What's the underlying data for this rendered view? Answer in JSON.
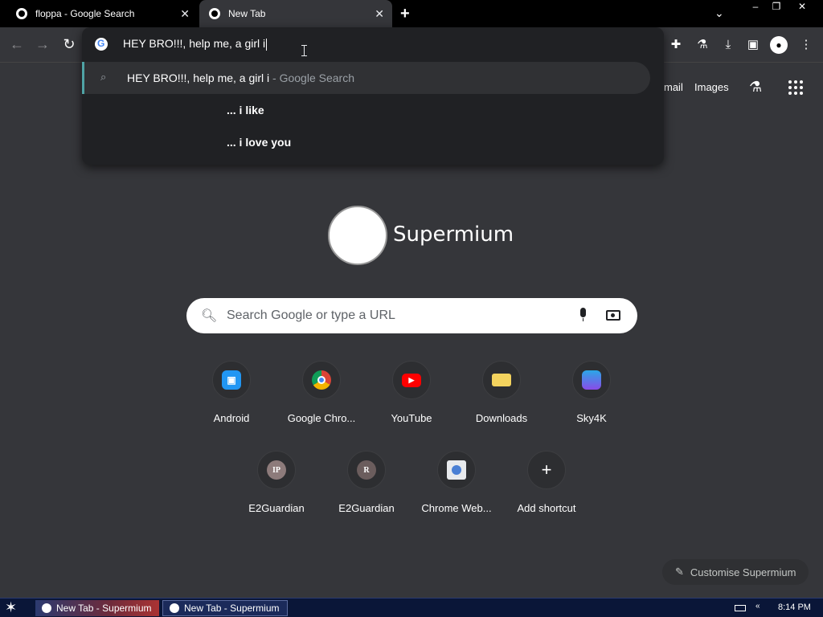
{
  "tabs": [
    {
      "title": "floppa - Google Search",
      "active": false
    },
    {
      "title": "New Tab",
      "active": true
    }
  ],
  "omnibox": {
    "typed_text": "HEY BRO!!!, help me, a girl i",
    "suggestions": [
      {
        "text": "HEY BRO!!!, help me, a girl i",
        "suffix": " - Google Search"
      },
      {
        "text": "... i like"
      },
      {
        "text": "... i love you"
      }
    ]
  },
  "header_links": {
    "gmail": "mail",
    "images": "Images"
  },
  "logo": {
    "text": "Supermium"
  },
  "search": {
    "placeholder": "Search Google or type a URL"
  },
  "shortcuts": [
    {
      "label": "Android",
      "icon": "android-icon",
      "color": "#2196f3"
    },
    {
      "label": "Google Chro...",
      "icon": "chrome-icon",
      "color": "#db4437"
    },
    {
      "label": "YouTube",
      "icon": "youtube-icon",
      "color": "#ff0000"
    },
    {
      "label": "Downloads",
      "icon": "downloads-icon",
      "color": "#f4d35e"
    },
    {
      "label": "Sky4K",
      "icon": "sky4k-icon",
      "color": "#2aa7e8"
    },
    {
      "label": "E2Guardian",
      "icon": "e2guardian-icon",
      "initials": "IP",
      "color": "#8d7b7b"
    },
    {
      "label": "E2Guardian",
      "icon": "e2guardian-icon",
      "initials": "R",
      "color": "#6b5d5d"
    },
    {
      "label": "Chrome Web...",
      "icon": "chrome-web-store-icon",
      "color": "#4a7fd4"
    },
    {
      "label": "Add shortcut",
      "icon": "plus-icon",
      "color": "#2d2e31"
    }
  ],
  "customise": {
    "label": "Customise Supermium"
  },
  "taskbar": {
    "tasks": [
      "New Tab - Supermium",
      "New Tab - Supermium"
    ],
    "clock": "8:14 PM"
  },
  "colors": {
    "page_bg": "#35363a",
    "omnibox_bg": "#202124",
    "taskbar_bg": "#0a1638",
    "accent": "#4fa3a5"
  }
}
